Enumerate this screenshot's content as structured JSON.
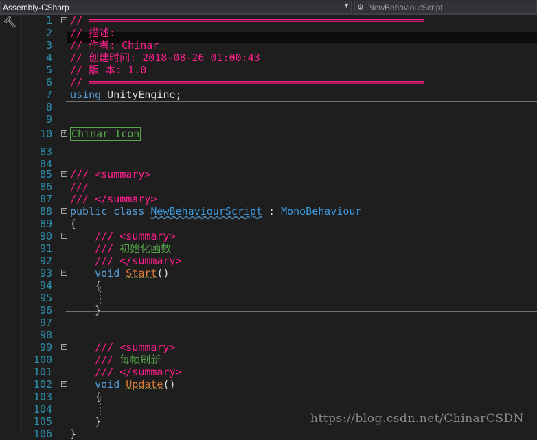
{
  "navbar": {
    "project": "Assembly-CSharp",
    "class_name": "NewBehaviourScript"
  },
  "watermark": "https://blog.csdn.net/ChinarCSDN",
  "lines": [
    {
      "n": "1",
      "fold": "-",
      "segs": [
        {
          "t": "// ══════════════════════════════════════════════════════",
          "c": "c-comment"
        }
      ]
    },
    {
      "n": "2",
      "segs": [
        {
          "t": "// 描述:",
          "c": "c-comment"
        }
      ]
    },
    {
      "n": "3",
      "segs": [
        {
          "t": "// 作者: Chinar",
          "c": "c-comment"
        }
      ]
    },
    {
      "n": "4",
      "segs": [
        {
          "t": "// 创建时间: 2018-08-26 01:00:43",
          "c": "c-comment"
        }
      ]
    },
    {
      "n": "5",
      "segs": [
        {
          "t": "// 版 本: 1.0",
          "c": "c-comment"
        }
      ]
    },
    {
      "n": "6",
      "segs": [
        {
          "t": "// ══════════════════════════════════════════════════════",
          "c": "c-comment"
        }
      ]
    },
    {
      "n": "7",
      "segs": [
        {
          "t": "using",
          "c": "c-kw"
        },
        {
          "t": " UnityEngine;",
          "c": ""
        }
      ]
    },
    {
      "n": "8",
      "segs": []
    },
    {
      "n": "9",
      "segs": []
    },
    {
      "n": "10",
      "fold": "+",
      "segs": [
        {
          "t": "Chinar Icon",
          "c": "c-region"
        }
      ]
    },
    {
      "n": "83",
      "segs": []
    },
    {
      "n": "84",
      "segs": []
    },
    {
      "n": "85",
      "fold": "-",
      "segs": [
        {
          "t": "/// <summary>",
          "c": "c-doc"
        }
      ]
    },
    {
      "n": "86",
      "segs": [
        {
          "t": "///",
          "c": "c-doc"
        }
      ]
    },
    {
      "n": "87",
      "segs": [
        {
          "t": "/// </summary>",
          "c": "c-doc"
        }
      ]
    },
    {
      "n": "88",
      "fold": "-",
      "segs": [
        {
          "t": "public class ",
          "c": "c-kw"
        },
        {
          "t": "NewBehaviourScript",
          "c": "c-type2 squiggle"
        },
        {
          "t": " : ",
          "c": ""
        },
        {
          "t": "MonoBehaviour",
          "c": "c-type2"
        }
      ]
    },
    {
      "n": "89",
      "segs": [
        {
          "t": "{",
          "c": ""
        }
      ]
    },
    {
      "n": "90",
      "fold": "-",
      "segs": [
        {
          "t": "    /// <summary>",
          "c": "c-doc"
        }
      ]
    },
    {
      "n": "91",
      "segs": [
        {
          "t": "    /// ",
          "c": "c-doc"
        },
        {
          "t": "初始化函数",
          "c": "c-green"
        }
      ]
    },
    {
      "n": "92",
      "segs": [
        {
          "t": "    /// </summary>",
          "c": "c-doc"
        }
      ]
    },
    {
      "n": "93",
      "fold": "-",
      "segs": [
        {
          "t": "    void ",
          "c": "c-kw"
        },
        {
          "t": "Start",
          "c": "c-method squiggle-g"
        },
        {
          "t": "()",
          "c": ""
        }
      ]
    },
    {
      "n": "94",
      "segs": [
        {
          "t": "    {",
          "c": ""
        }
      ]
    },
    {
      "n": "95",
      "segs": []
    },
    {
      "n": "96",
      "segs": [
        {
          "t": "    }",
          "c": ""
        }
      ]
    },
    {
      "n": "97",
      "segs": []
    },
    {
      "n": "98",
      "segs": []
    },
    {
      "n": "99",
      "fold": "-",
      "segs": [
        {
          "t": "    /// <summary>",
          "c": "c-doc"
        }
      ]
    },
    {
      "n": "100",
      "segs": [
        {
          "t": "    /// ",
          "c": "c-doc"
        },
        {
          "t": "每帧刷新",
          "c": "c-green"
        }
      ]
    },
    {
      "n": "101",
      "segs": [
        {
          "t": "    /// </summary>",
          "c": "c-doc"
        }
      ]
    },
    {
      "n": "102",
      "fold": "-",
      "segs": [
        {
          "t": "    void ",
          "c": "c-kw"
        },
        {
          "t": "Update",
          "c": "c-method squiggle-g"
        },
        {
          "t": "()",
          "c": ""
        }
      ]
    },
    {
      "n": "103",
      "segs": [
        {
          "t": "    {",
          "c": ""
        }
      ]
    },
    {
      "n": "104",
      "segs": []
    },
    {
      "n": "105",
      "segs": [
        {
          "t": "    }",
          "c": ""
        }
      ]
    },
    {
      "n": "106",
      "segs": [
        {
          "t": "}",
          "c": ""
        }
      ]
    }
  ]
}
